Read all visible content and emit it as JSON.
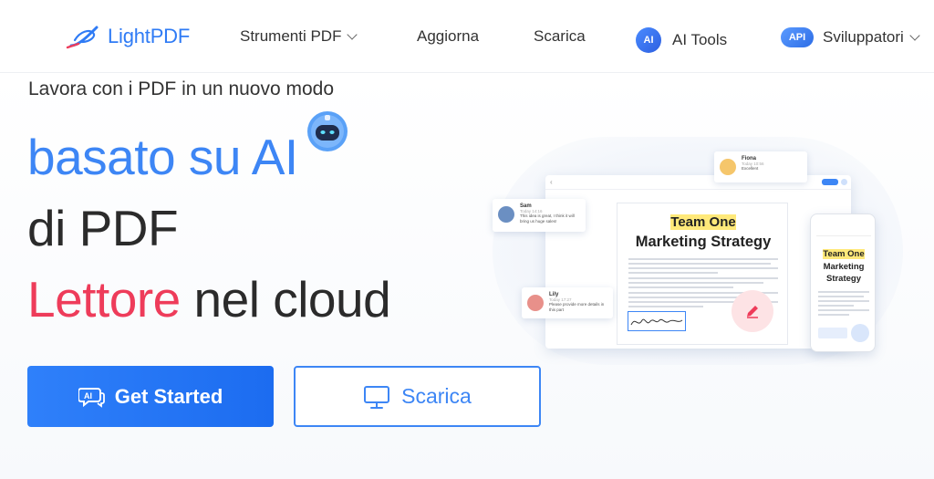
{
  "brand": {
    "name": "LightPDF",
    "accent": "#2f7bf5"
  },
  "nav": {
    "items": [
      {
        "label": "Strumenti PDF",
        "has_dropdown": true
      },
      {
        "label": "Aggiorna"
      },
      {
        "label": "Scarica"
      },
      {
        "label": "AI Tools",
        "badge": "AI"
      },
      {
        "label": "Sviluppatori",
        "badge": "API",
        "has_dropdown": true
      }
    ]
  },
  "hero": {
    "tagline": "Lavora con i PDF in un nuovo modo",
    "line1": "basato su AI",
    "line2": "di PDF",
    "line3_highlight": "Lettore",
    "line3_rest": " nel cloud",
    "colors": {
      "blue": "#3d86f5",
      "red": "#ee3c5a"
    }
  },
  "buttons": {
    "primary": {
      "label": "Get Started",
      "icon": "ai-chat-icon"
    },
    "secondary": {
      "label": "Scarica",
      "icon": "monitor-icon"
    }
  },
  "illustration": {
    "doc_title_1": "Team One",
    "doc_title_2": "Marketing Strategy",
    "phone_title_1": "Team One",
    "phone_title_2": "Marketing",
    "phone_title_3": "Strategy",
    "comments": [
      {
        "name": "Fiona",
        "date": "Today 10:56",
        "text": "Excellent"
      },
      {
        "name": "Sam",
        "date": "Today 14:16",
        "text": "This idea is great, I think it will bring us huge sales!"
      },
      {
        "name": "Lily",
        "date": "Today 17:27",
        "text": "Please provide more details in this part"
      }
    ]
  }
}
